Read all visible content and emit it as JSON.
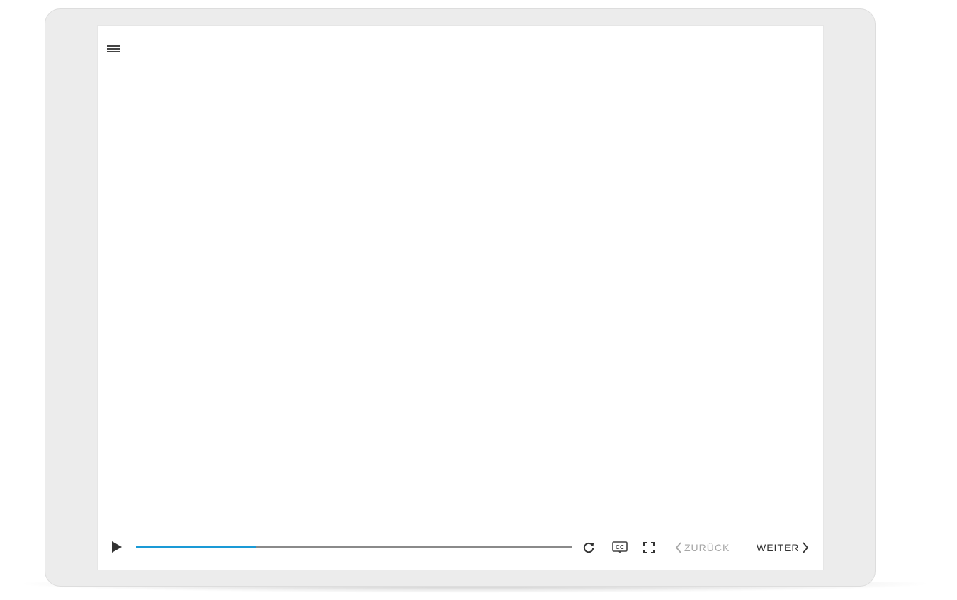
{
  "player": {
    "controls": {
      "play_icon": "play-icon",
      "progress_fraction": 0.275,
      "replay_icon": "replay-icon",
      "captions_icon": "closed-captions-icon",
      "captions_label": "CC",
      "fullscreen_icon": "fullscreen-icon",
      "prev_label": "ZURÜCK",
      "next_label": "WEITER"
    },
    "menu_icon": "hamburger-menu-icon"
  },
  "colors": {
    "accent": "#1a9ad6",
    "track": "#8a8a8a",
    "frame": "#ececec",
    "icon": "#444444",
    "disabled_text": "#a6a6a6",
    "text": "#333333"
  }
}
